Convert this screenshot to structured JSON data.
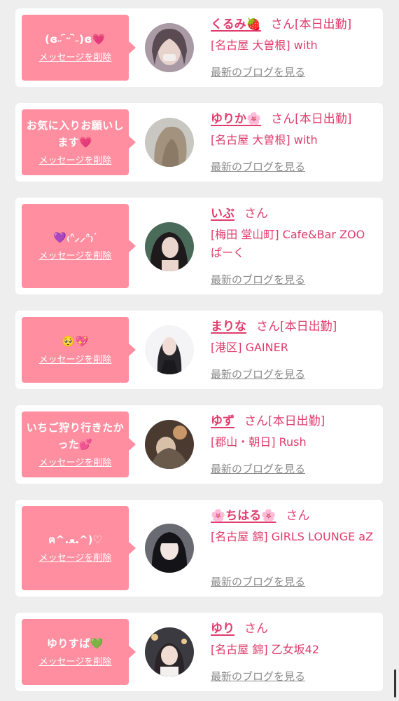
{
  "delete_label": "メッセージを削除",
  "blog_label": "最新のブログを見る",
  "san": "さん",
  "items": [
    {
      "message": "(ɞ˶ ᷇ᵕ ᷆˶)ɞ💗",
      "name": "くるみ🍓",
      "status": "[本日出勤]",
      "shop": "[名古屋 大曽根] with"
    },
    {
      "message": "お気に入りお願いします💗",
      "name": "ゆりか🌸",
      "status": "[本日出勤]",
      "shop": "[名古屋 大曽根] with"
    },
    {
      "message": "💜₍ᐢ⸝⸝ᐢ₎ᐝ",
      "name": "いぶ",
      "status": "",
      "shop": "[梅田 堂山町] Cafe&Bar ZOO ぱーく"
    },
    {
      "message": "🥺💖",
      "name": "まりな",
      "status": "[本日出勤]",
      "shop": "[港区] GAINER"
    },
    {
      "message": "いちご狩り行きたかった💕",
      "name": "ゆず",
      "status": "[本日出勤]",
      "shop": "[郡山・朝日] Rush"
    },
    {
      "message": "ฅ^.ﻌ.^)♡",
      "name": "🌸ちはる🌸",
      "status": "",
      "shop": "[名古屋 錦] GIRLS LOUNGE aZ"
    },
    {
      "message": "ゆりすぱ💚",
      "name": "ゆり",
      "status": "",
      "shop": "[名古屋 錦] 乙女坂42"
    }
  ],
  "colors": {
    "accent": "#e03c6e",
    "bubble": "#ff8fa0",
    "background": "#eeeeee"
  }
}
